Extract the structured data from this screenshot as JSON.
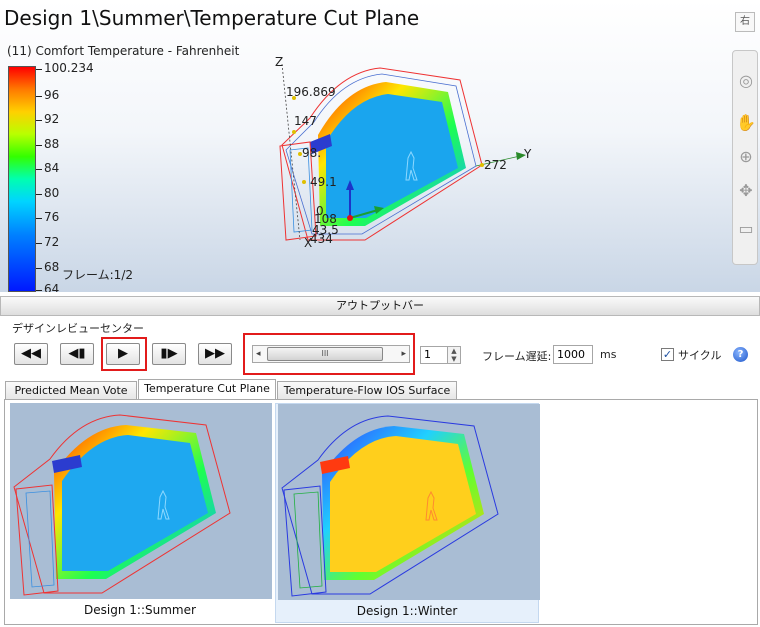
{
  "viewport": {
    "title": "Design 1\\Summer\\Temperature Cut Plane",
    "legend_title": "(11) Comfort Temperature - Fahrenheit",
    "legend_ticks": [
      "100.234",
      "96",
      "92",
      "88",
      "84",
      "80",
      "76",
      "72",
      "68",
      "64"
    ],
    "frame_label": "フレーム:1/2",
    "axis_z": "Z",
    "axis_y": "Y",
    "axis_x": "X",
    "dim_labels": [
      "196.869",
      "147",
      "98.",
      "49.1",
      "0",
      "108",
      "272",
      "43.5",
      "434"
    ],
    "corner_button": "右"
  },
  "view_toolbar": {
    "icons": [
      "orbit-icon",
      "pan-hand-icon",
      "zoom-icon",
      "rotate-icon",
      "fit-view-icon"
    ]
  },
  "output_bar": {
    "label": "アウトプットバー"
  },
  "review_center": {
    "label": "デザインレビューセンター",
    "buttons": {
      "first": "◀◀",
      "prev": "◀▮",
      "play": "▶",
      "next": "▮▶",
      "last": "▶▶"
    },
    "slider_grip": "III",
    "frame_value": "1",
    "frame_delay_label": "フレーム遅延:",
    "frame_delay_value": "1000",
    "delay_unit": "ms",
    "cycle_label": "サイクル",
    "cycle_checked": true,
    "help": "?"
  },
  "tabs": [
    {
      "label": "Predicted Mean Vote",
      "active": false
    },
    {
      "label": "Temperature Cut Plane",
      "active": true
    },
    {
      "label": "Temperature-Flow IOS Surface",
      "active": false
    }
  ],
  "thumbnails": [
    {
      "caption": "Design 1::Summer",
      "selected": false
    },
    {
      "caption": "Design 1::Winter",
      "selected": true
    }
  ],
  "colors": {
    "highlight": "#e21b1b",
    "summer_plane": "#1ea8f0",
    "winter_plane": "#ffd21f"
  }
}
